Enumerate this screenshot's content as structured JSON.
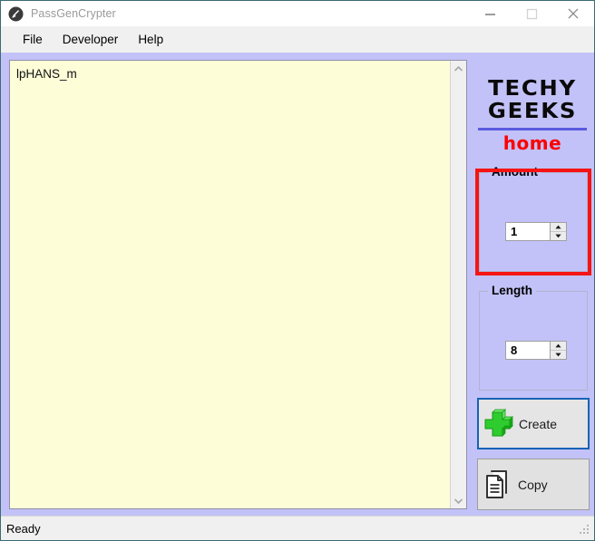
{
  "window": {
    "title": "PassGenCrypter",
    "icon": "app-key-icon",
    "controls": {
      "minimize": "minimize-icon",
      "maximize": "maximize-icon",
      "close": "close-icon"
    }
  },
  "menu": {
    "items": [
      {
        "label": "File"
      },
      {
        "label": "Developer"
      },
      {
        "label": "Help"
      }
    ]
  },
  "output": {
    "text": "lpHANS_m",
    "scrollbar": {
      "up_icon": "chevron-up-icon",
      "down_icon": "chevron-down-icon"
    }
  },
  "logo": {
    "line1": "TECHY",
    "line2": "GEEKS",
    "tagline": "home",
    "rule_color": "#5a5ae0",
    "tagline_color": "#fc0000",
    "text_color": "#0a0a0a"
  },
  "amount": {
    "title": "Amount",
    "value": "1",
    "highlight_color": "#f51414",
    "up_icon": "spinner-up-icon",
    "down_icon": "spinner-down-icon"
  },
  "length": {
    "title": "Length",
    "value": "8",
    "up_icon": "spinner-up-icon",
    "down_icon": "spinner-down-icon"
  },
  "actions": {
    "create": {
      "label": "Create",
      "icon": "green-plus-icon",
      "focus_color": "#1763b6"
    },
    "copy": {
      "label": "Copy",
      "icon": "copy-document-icon"
    }
  },
  "status": {
    "text": "Ready",
    "grip_icon": "resize-grip-icon"
  },
  "theme": {
    "background": "#c2c2f8",
    "textarea_background": "#fdfdd8",
    "chrome": "#f0f0f0"
  }
}
